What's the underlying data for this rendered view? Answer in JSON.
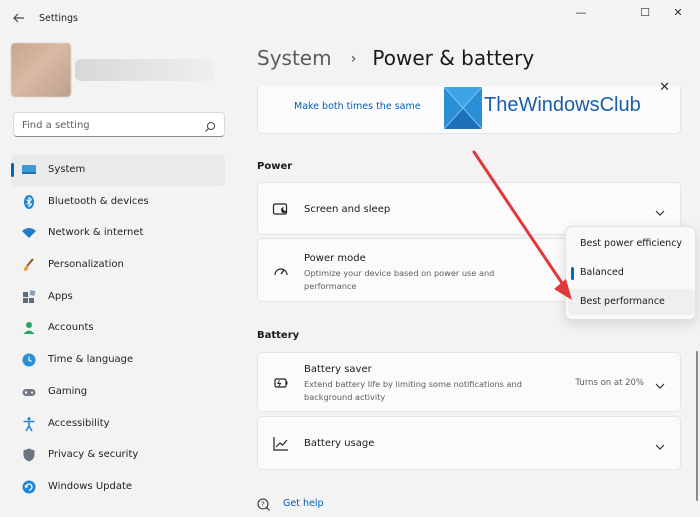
{
  "window": {
    "title": "Settings",
    "controls": {
      "minimize": "—",
      "maximize": "☐",
      "close": "✕"
    }
  },
  "search": {
    "placeholder": "Find a setting"
  },
  "sidebar": {
    "items": [
      {
        "label": "System",
        "icon": "system-icon",
        "active": true
      },
      {
        "label": "Bluetooth & devices",
        "icon": "bluetooth-icon"
      },
      {
        "label": "Network & internet",
        "icon": "wifi-icon"
      },
      {
        "label": "Personalization",
        "icon": "brush-icon"
      },
      {
        "label": "Apps",
        "icon": "apps-icon"
      },
      {
        "label": "Accounts",
        "icon": "person-icon"
      },
      {
        "label": "Time & language",
        "icon": "globe-icon"
      },
      {
        "label": "Gaming",
        "icon": "gamepad-icon"
      },
      {
        "label": "Accessibility",
        "icon": "accessibility-icon"
      },
      {
        "label": "Privacy & security",
        "icon": "shield-icon"
      },
      {
        "label": "Windows Update",
        "icon": "update-icon"
      }
    ]
  },
  "header": {
    "parent": "System",
    "current": "Power & battery"
  },
  "top_card": {
    "link": "Make both times the same"
  },
  "watermark": {
    "text": "TheWindowsClub"
  },
  "power": {
    "section_title": "Power",
    "screen_sleep": {
      "title": "Screen and sleep"
    },
    "power_mode": {
      "title": "Power mode",
      "description": "Optimize your device based on power use and performance",
      "options": [
        "Best power efficiency",
        "Balanced",
        "Best performance"
      ],
      "selected": "Balanced",
      "hovered": "Best performance"
    }
  },
  "battery": {
    "section_title": "Battery",
    "saver": {
      "title": "Battery saver",
      "description": "Extend battery life by limiting some notifications and background activity",
      "status": "Turns on at 20%"
    },
    "usage": {
      "title": "Battery usage"
    }
  },
  "help": {
    "label": "Get help"
  },
  "colors": {
    "accent": "#0067c0",
    "link": "#005fb8",
    "annotation_arrow": "#e0393a"
  }
}
